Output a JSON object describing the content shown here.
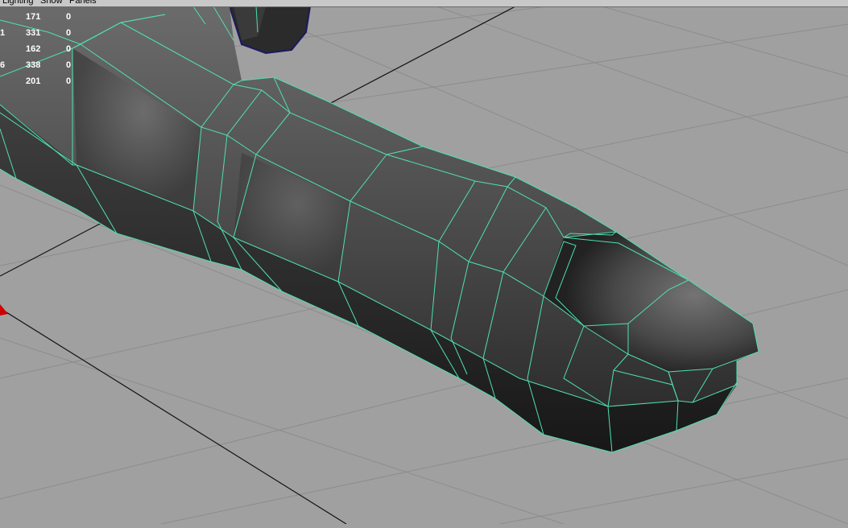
{
  "menu": {
    "items": [
      "Lighting",
      "Show",
      "Panels"
    ]
  },
  "hud": {
    "rows": [
      {
        "label": "",
        "col1": "171",
        "col2": "0"
      },
      {
        "label": "1",
        "col1": "331",
        "col2": "0"
      },
      {
        "label": "",
        "col1": "162",
        "col2": "0"
      },
      {
        "label": "6",
        "col1": "338",
        "col2": "0"
      },
      {
        "label": "",
        "col1": "201",
        "col2": "0"
      }
    ]
  },
  "colors": {
    "background": "#a0a0a0",
    "grid": "#8a8a8a",
    "axis": "#000000",
    "wireframe": "#4fe0b0",
    "mesh_dark": "#2a2a2a",
    "mesh_light": "#6e6e6e",
    "axis_marker": "#cc0000"
  }
}
